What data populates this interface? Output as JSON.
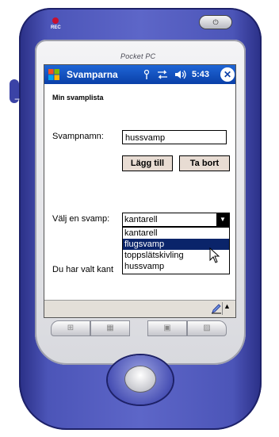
{
  "device": {
    "brand": "Pocket PC",
    "rec_label": "REC",
    "power_symbol": "⏻",
    "side_plus": "+",
    "side_minus": "−",
    "hardware_buttons": [
      "⊞",
      "▦",
      "▣",
      "▨"
    ]
  },
  "titlebar": {
    "start_icon": "windows-flag-icon",
    "title": "Svamparna",
    "signal_icon": "antenna-icon",
    "sync_icon": "sync-arrows-icon",
    "volume_icon": "speaker-icon",
    "time": "5:43",
    "close_label": "✕"
  },
  "form": {
    "heading": "Min svamplista",
    "name_label": "Svampnamn:",
    "name_value": "hussvamp",
    "add_button": "Lägg till",
    "remove_button": "Ta bort",
    "select_label": "Välj en svamp:",
    "selected_value": "kantarell",
    "options": [
      "kantarell",
      "flugsvamp",
      "toppslätskivling",
      "hussvamp"
    ],
    "highlighted_option": "flugsvamp",
    "result_text": "Du har valt kant"
  },
  "menubar": {
    "input_icon": "pencil-icon",
    "arrow_label": "▲"
  },
  "colors": {
    "titlebar": "#0a3fa8",
    "button_bg": "#e8dcd3",
    "selection": "#0a246a",
    "device_body": "#4c55b8"
  }
}
